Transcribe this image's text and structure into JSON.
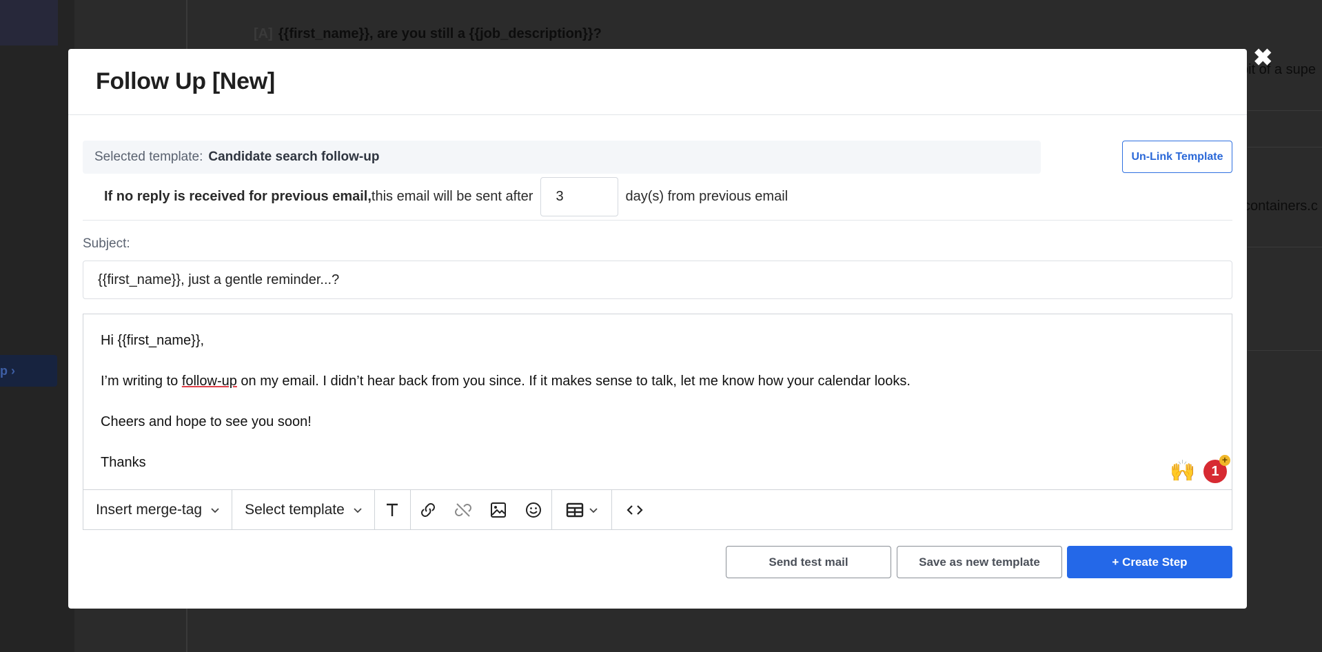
{
  "background": {
    "heading_tag": "[A]",
    "heading": "{{first_name}}, are you still a {{job_description}}?",
    "right_text_1": "bit of a supe",
    "right_text_2": "containers.c",
    "side_pill": "p"
  },
  "modal": {
    "title": "Follow Up [New]",
    "close_glyph": "✖"
  },
  "template": {
    "label": "Selected template:",
    "name": "Candidate search follow-up",
    "unlink_label": "Un-Link Template"
  },
  "delay": {
    "bold_text": "If no reply is received for previous email,",
    "text_before": "this email will be sent after",
    "days_value": "3",
    "text_after": "day(s) from previous email"
  },
  "subject": {
    "label": "Subject:",
    "value": "{{first_name}}, just a gentle reminder...?"
  },
  "body": {
    "greeting": "Hi {{first_name}},",
    "line1_before": "I’m writing to ",
    "line1_misspelled": "follow-up",
    "line1_after": " on my email. I didn’t hear back from you since. If it makes sense to talk, let me know how your calendar looks.",
    "line2": "Cheers and hope to see you soon!",
    "line3": "Thanks",
    "emoji": "🙌",
    "notification_count": "1",
    "notification_plus": "+"
  },
  "toolbar": {
    "merge_tag_label": "Insert merge-tag",
    "select_template_label": "Select template",
    "icons": [
      "text-format-icon",
      "link-icon",
      "unlink-icon",
      "image-icon",
      "emoji-icon",
      "table-icon",
      "code-view-icon"
    ]
  },
  "actions": {
    "send_test": "Send test mail",
    "save_template": "Save as new template",
    "create_step": "+ Create Step"
  },
  "colors": {
    "primary": "#2468e8",
    "badge": "#d72a32",
    "overlay": "#2b2b2b"
  }
}
